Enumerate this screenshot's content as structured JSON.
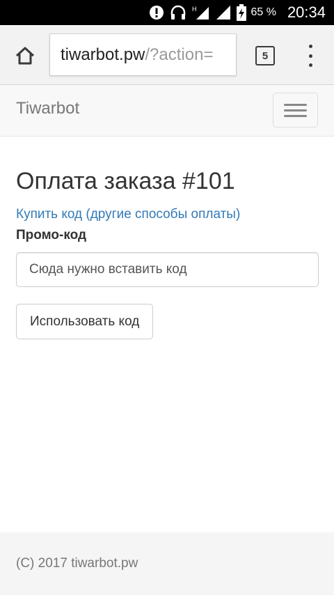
{
  "status_bar": {
    "battery": "65 %",
    "time": "20:34",
    "icons": [
      "alert-icon",
      "headphones-icon",
      "signal-h-icon",
      "signal-icon",
      "battery-charging-icon"
    ]
  },
  "browser": {
    "url_host": "tiwarbot.pw",
    "url_path": "/?action=",
    "tab_count": "5",
    "icons": [
      "home-icon",
      "tabs-icon",
      "overflow-menu-icon"
    ]
  },
  "navbar": {
    "brand": "Tiwarbot",
    "icons": [
      "hamburger-icon"
    ]
  },
  "main": {
    "title": "Оплата заказа #101",
    "buy_link": "Купить код (другие способы оплаты)",
    "promo_label": "Промо-код",
    "promo_placeholder": "Сюда нужно вставить код",
    "promo_value": "",
    "submit_label": "Использовать код"
  },
  "footer": {
    "text": "(C) 2017 tiwarbot.pw"
  }
}
